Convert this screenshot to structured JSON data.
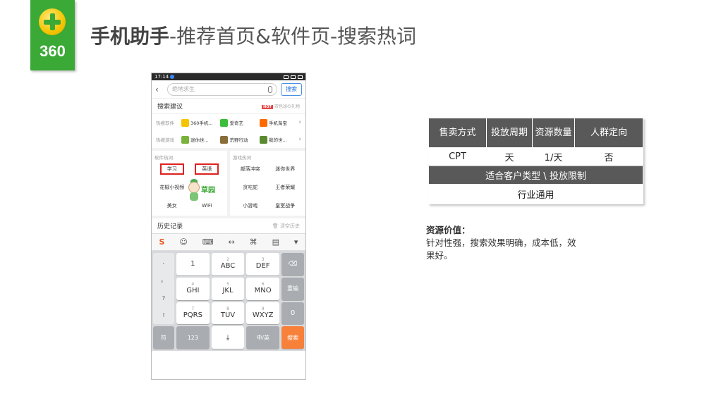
{
  "logo": {
    "text": "360",
    "accent": "#3aa935"
  },
  "title": {
    "bold": "手机助手",
    "rest": "-推荐首页&软件页-搜索热词"
  },
  "phone": {
    "status": {
      "time": "17:14"
    },
    "search": {
      "placeholder": "绝地求生",
      "button": "搜索"
    },
    "suggest": {
      "title": "搜索建议",
      "hot_badge": "HOT",
      "hot_text": "双色球の礼物"
    },
    "hot_software": {
      "label": "热搜软件",
      "items": [
        "360手机...",
        "爱奇艺",
        "手机淘宝"
      ]
    },
    "hot_games": {
      "label": "热搜游戏",
      "items": [
        "迷你世...",
        "荒野行动",
        "我的世..."
      ]
    },
    "software_words": {
      "title": "软件热词",
      "items": [
        "学习",
        "英语",
        "花椒小视频",
        "",
        "美女",
        "WiFi"
      ]
    },
    "mascot_text": "草园",
    "game_words": {
      "title": "游戏热词",
      "items": [
        "部落冲突",
        "迷你世界",
        "贪吃蛇",
        "王者荣耀",
        "小游戏",
        "皇室战争"
      ]
    },
    "history": {
      "title": "历史记录",
      "clear": "清空历史"
    },
    "keyboard": {
      "punct": [
        ",",
        "。",
        "?",
        "!"
      ],
      "row1": [
        {
          "num": "",
          "label": "1"
        },
        {
          "num": "2",
          "label": "ABC"
        },
        {
          "num": "3",
          "label": "DEF"
        }
      ],
      "row2": [
        {
          "num": "4",
          "label": "GHI"
        },
        {
          "num": "5",
          "label": "JKL"
        },
        {
          "num": "6",
          "label": "MNO"
        }
      ],
      "row3": [
        {
          "num": "7",
          "label": "PQRS"
        },
        {
          "num": "8",
          "label": "TUV"
        },
        {
          "num": "9",
          "label": "WXYZ"
        }
      ],
      "reenter": "重输",
      "zero": "0",
      "symbol": "符",
      "num123": "123",
      "lang": "中/英",
      "search": "搜索"
    }
  },
  "table": {
    "headers": [
      "售卖方式",
      "投放周期",
      "资源数量",
      "人群定向"
    ],
    "values": [
      "CPT",
      "天",
      "1/天",
      "否"
    ],
    "sub_header": "适合客户类型 \\ 投放限制",
    "sub_value": "行业通用"
  },
  "value_desc": {
    "label": "资源价值：",
    "text": "针对性强，搜索效果明确，成本低，效果好。"
  }
}
